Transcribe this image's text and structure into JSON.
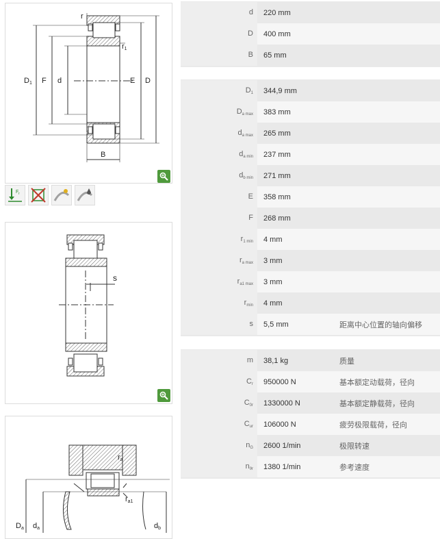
{
  "drawing1": {
    "labels": {
      "r": "r",
      "r1": "r",
      "r1_sub": "1",
      "D1": "D",
      "D1_sub": "1",
      "F": "F",
      "d": "d",
      "E": "E",
      "D": "D",
      "B": "B"
    }
  },
  "drawing2": {
    "labels": {
      "s": "s"
    }
  },
  "drawing3": {
    "labels": {
      "ra": "r",
      "ra_sub": "a",
      "ra1": "r",
      "ra1_sub": "a1",
      "Da": "D",
      "Da_sub": "a",
      "da": "d",
      "da_sub": "a",
      "db": "d",
      "db_sub": "b"
    }
  },
  "table1": [
    {
      "key": "d",
      "sub": "",
      "value": "220  mm",
      "desc": ""
    },
    {
      "key": "D",
      "sub": "",
      "value": "400  mm",
      "desc": ""
    },
    {
      "key": "B",
      "sub": "",
      "value": "65  mm",
      "desc": ""
    }
  ],
  "table2": [
    {
      "key": "D",
      "sub": "1",
      "value": "344,9  mm",
      "desc": ""
    },
    {
      "key": "D",
      "sub": "a max",
      "value": "383  mm",
      "desc": ""
    },
    {
      "key": "d",
      "sub": "a max",
      "value": "265  mm",
      "desc": ""
    },
    {
      "key": "d",
      "sub": "a min",
      "value": "237  mm",
      "desc": ""
    },
    {
      "key": "d",
      "sub": "b min",
      "value": "271  mm",
      "desc": ""
    },
    {
      "key": "E",
      "sub": "",
      "value": "358  mm",
      "desc": ""
    },
    {
      "key": "F",
      "sub": "",
      "value": "268  mm",
      "desc": ""
    },
    {
      "key": "r",
      "sub": "1 min",
      "value": "4  mm",
      "desc": ""
    },
    {
      "key": "r",
      "sub": "a max",
      "value": "3  mm",
      "desc": ""
    },
    {
      "key": "r",
      "sub": "a1 max",
      "value": "3  mm",
      "desc": ""
    },
    {
      "key": "r",
      "sub": "min",
      "value": "4  mm",
      "desc": ""
    },
    {
      "key": "s",
      "sub": "",
      "value": "5,5  mm",
      "desc": "距离中心位置的轴向偏移"
    }
  ],
  "table3": [
    {
      "key": "m",
      "sub": "",
      "value": "38,1  kg",
      "desc": "质量"
    },
    {
      "key": "C",
      "sub": "r",
      "value": "950000  N",
      "desc": "基本额定动载荷，径向"
    },
    {
      "key": "C",
      "sub": "0r",
      "value": "1330000  N",
      "desc": "基本额定静载荷，径向"
    },
    {
      "key": "C",
      "sub": "ur",
      "value": "106000  N",
      "desc": "疲劳极限载荷，径向"
    },
    {
      "key": "n",
      "sub": "G",
      "value": "2600  1/min",
      "desc": "极限转速"
    },
    {
      "key": "n",
      "sub": "ϑr",
      "value": "1380  1/min",
      "desc": "参考速度"
    }
  ],
  "colors": {
    "zoom": "#4f9a3c",
    "hatch": "#d4a37a",
    "label_bg": "#eeeeee"
  },
  "icons": [
    "zoom-icon",
    "radial-load-icon",
    "no-misalignment-icon",
    "lubrication-icon",
    "grease-icon"
  ]
}
